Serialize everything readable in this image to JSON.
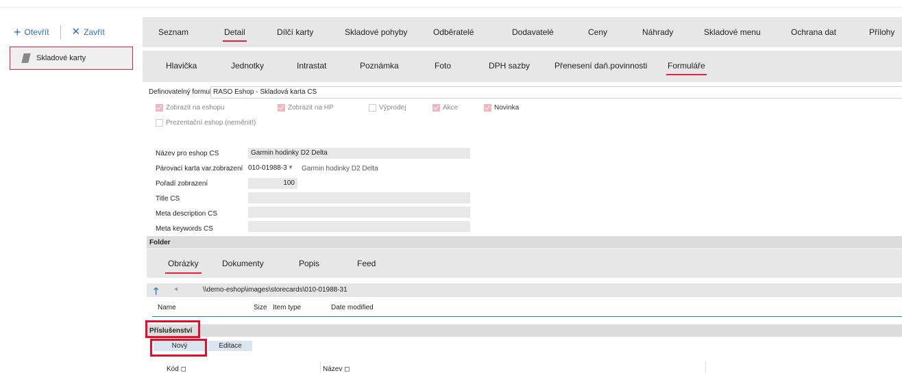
{
  "left": {
    "open_label": "Otevřít",
    "close_label": "Zavřít",
    "card_label": "Skladové karty"
  },
  "main_tabs": [
    "Seznam",
    "Detail",
    "Dílčí karty",
    "Skladové pohyby",
    "Odběratelé",
    "Dodavatelé",
    "Ceny",
    "Náhrady",
    "Skladové menu",
    "Ochrana dat",
    "Přílohy"
  ],
  "active_main_tab": "Detail",
  "sub_tabs": [
    "Hlavička",
    "Jednotky",
    "Intrastat",
    "Poznámka",
    "Foto",
    "DPH sazby",
    "Přenesení daň.povinnosti",
    "Formuláře"
  ],
  "active_sub_tab": "Formuláře",
  "form": {
    "definable_label": "Definovatelný formulář:",
    "definable_value": "RASO Eshop - Skladová karta CS",
    "checkboxes": [
      {
        "label": "Zobrazit na eshopu",
        "checked": true
      },
      {
        "label": "Zobrazit na HP",
        "checked": true
      },
      {
        "label": "Výprodej",
        "checked": false
      },
      {
        "label": "Akce",
        "checked": true
      },
      {
        "label": "Novinka",
        "checked": true
      },
      {
        "label": "Prezentační eshop (neměnit!)",
        "checked": false
      }
    ],
    "name_label": "Název pro eshop CS",
    "name_value": "Garmin hodinky D2 Delta",
    "pair_label": "Párovací karta var.zobrazení",
    "pair_code": "010-01988-3",
    "pair_name": "Garmin hodinky D2 Delta",
    "order_label": "Pořadí zobrazení",
    "order_value": "100",
    "title_label": "Title CS",
    "meta_desc_label": "Meta description CS",
    "meta_kw_label": "Meta keywords CS"
  },
  "folder": {
    "title": "Folder",
    "tabs": [
      "Obrázky",
      "Dokumenty",
      "Popis",
      "Feed"
    ],
    "active_tab": "Obrázky",
    "path": "\\\\demo-eshop\\images\\storecards\\010-01988-31",
    "columns": [
      "Name",
      "Size",
      "Item type",
      "Date modified"
    ]
  },
  "accessories": {
    "title": "Příslušenství",
    "new_label": "Nový",
    "edit_label": "Editace",
    "col_code": "Kód ◻",
    "col_name": "Název ◻"
  },
  "colors": {
    "accent": "#e0223e",
    "link": "#2a6fc9"
  }
}
